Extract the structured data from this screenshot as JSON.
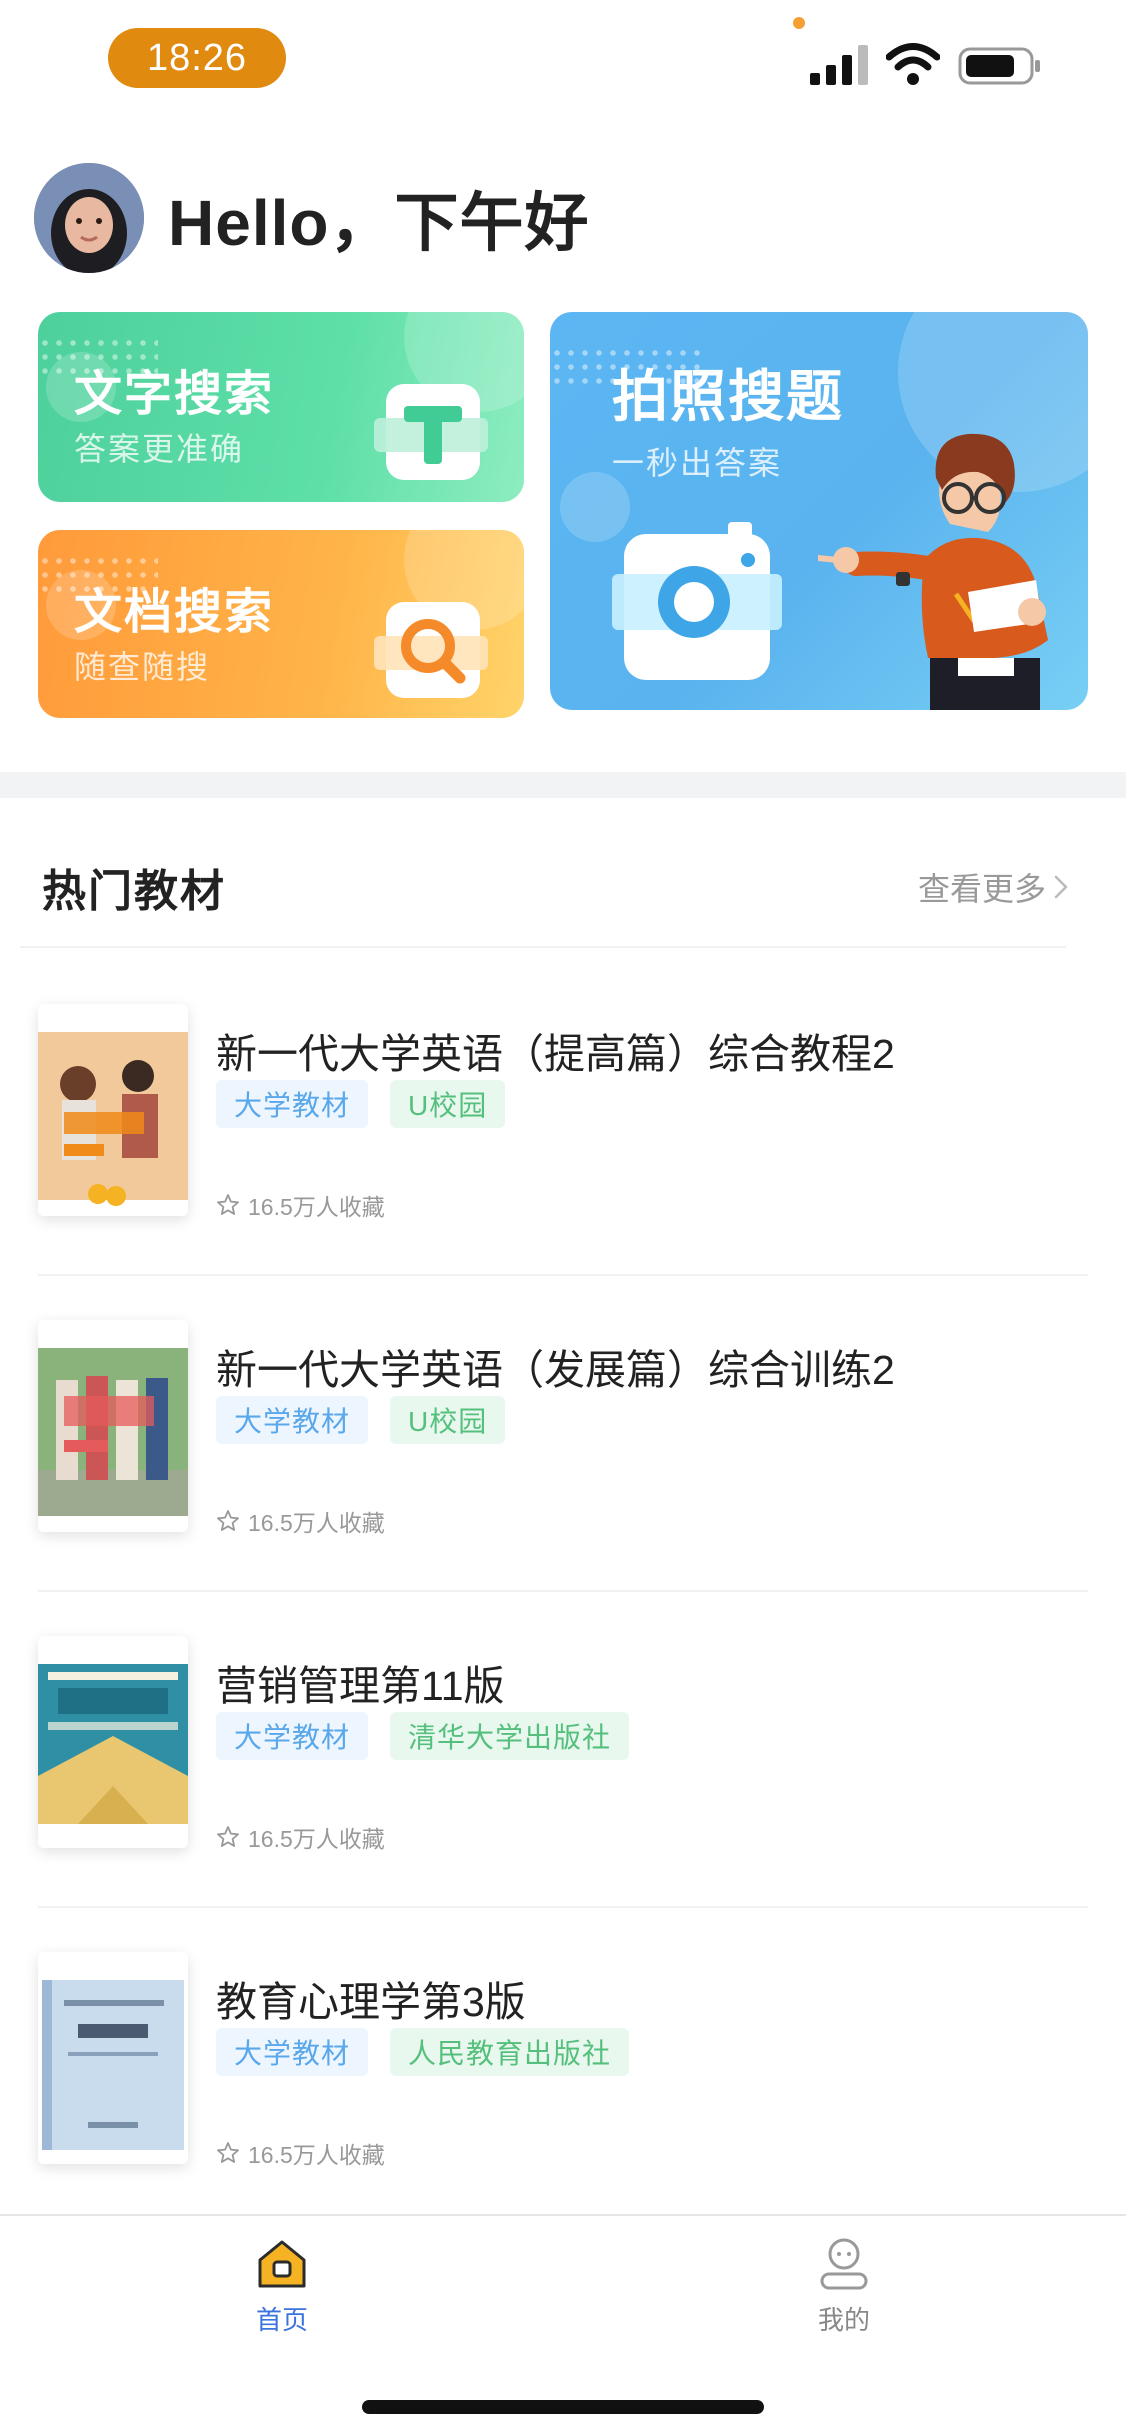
{
  "status_bar": {
    "time": "18:26",
    "signal_icon": "cellular-signal-icon",
    "wifi_icon": "wifi-icon",
    "battery_icon": "battery-icon"
  },
  "header": {
    "greeting": "Hello，下午好",
    "avatar_icon": "user-avatar"
  },
  "search_cards": {
    "text_search": {
      "title": "文字搜索",
      "subtitle": "答案更准确",
      "icon": "text-t-icon"
    },
    "doc_search": {
      "title": "文档搜索",
      "subtitle": "随查随搜",
      "icon": "magnifier-doc-icon"
    },
    "photo_search": {
      "title": "拍照搜题",
      "subtitle": "一秒出答案",
      "icon": "camera-icon"
    }
  },
  "hot_books": {
    "title": "热门教材",
    "more_label": "查看更多",
    "items": [
      {
        "title": "新一代大学英语（提高篇）综合教程2",
        "tags": [
          "大学教材",
          "U校园"
        ],
        "favorites": "16.5万人收藏",
        "cover_color": "#F4A64A"
      },
      {
        "title": "新一代大学英语（发展篇）综合训练2",
        "tags": [
          "大学教材",
          "U校园"
        ],
        "favorites": "16.5万人收藏",
        "cover_color": "#6FAF6A"
      },
      {
        "title": "营销管理第11版",
        "tags": [
          "大学教材",
          "清华大学出版社"
        ],
        "favorites": "16.5万人收藏",
        "cover_color": "#2E8FA5"
      },
      {
        "title": "教育心理学第3版",
        "tags": [
          "大学教材",
          "人民教育出版社"
        ],
        "favorites": "16.5万人收藏",
        "cover_color": "#BFD6EC"
      }
    ]
  },
  "tab_bar": {
    "home_label": "首页",
    "mine_label": "我的",
    "home_icon": "home-icon",
    "mine_icon": "profile-icon",
    "active_color": "#3C73DE"
  }
}
